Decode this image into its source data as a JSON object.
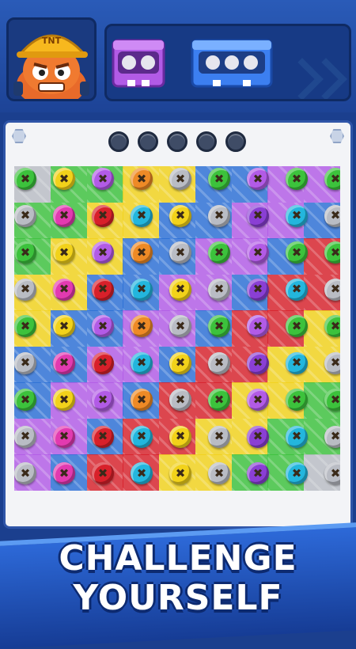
{
  "avatar": {
    "badge_text": "TNT",
    "icon": "miner-character-icon"
  },
  "toolboxes": [
    {
      "name": "purple-toolbox",
      "color": "#b25be6",
      "holes": 2
    },
    {
      "name": "blue-toolbox",
      "color": "#3c7ff0",
      "holes": 3
    }
  ],
  "slots": {
    "count": 5,
    "color": "#3f4c66"
  },
  "banner": {
    "line1": "CHALLENGE",
    "line2": "YOURSELF"
  },
  "palette": {
    "G": "#3cc23c",
    "Y": "#f2d21a",
    "P": "#b25be6",
    "O": "#ee8a26",
    "S": "#b9bcc4",
    "M": "#e23ab0",
    "R": "#d8202a",
    "C": "#23b6dd",
    "B": "#2a6fd6",
    "V": "#8a3fd4"
  },
  "board_colors": [
    [
      "S",
      "G",
      "G",
      "Y",
      "Y",
      "B",
      "B",
      "P",
      "P"
    ],
    [
      "G",
      "G",
      "Y",
      "Y",
      "B",
      "B",
      "P",
      "P",
      "B"
    ],
    [
      "G",
      "Y",
      "Y",
      "B",
      "B",
      "P",
      "P",
      "B",
      "R"
    ],
    [
      "Y",
      "Y",
      "B",
      "B",
      "P",
      "P",
      "B",
      "R",
      "R"
    ],
    [
      "Y",
      "B",
      "B",
      "P",
      "P",
      "B",
      "R",
      "R",
      "Y"
    ],
    [
      "B",
      "B",
      "P",
      "P",
      "B",
      "R",
      "R",
      "Y",
      "Y"
    ],
    [
      "B",
      "P",
      "P",
      "B",
      "R",
      "R",
      "Y",
      "Y",
      "G"
    ],
    [
      "P",
      "P",
      "B",
      "R",
      "R",
      "Y",
      "Y",
      "G",
      "G"
    ],
    [
      "P",
      "B",
      "R",
      "R",
      "Y",
      "Y",
      "G",
      "G",
      "S"
    ]
  ],
  "screws": [
    [
      "G",
      "Y",
      "P",
      "O",
      "S",
      "G",
      "P",
      "G",
      "G"
    ],
    [
      "S",
      "M",
      "R",
      "C",
      "Y",
      "S",
      "V",
      "C",
      "S"
    ],
    [
      "G",
      "Y",
      "P",
      "O",
      "S",
      "G",
      "P",
      "G",
      "G"
    ],
    [
      "S",
      "M",
      "R",
      "C",
      "Y",
      "S",
      "V",
      "C",
      "S"
    ],
    [
      "G",
      "Y",
      "P",
      "O",
      "S",
      "G",
      "P",
      "G",
      "G"
    ],
    [
      "S",
      "M",
      "R",
      "C",
      "Y",
      "S",
      "V",
      "C",
      "S"
    ],
    [
      "G",
      "Y",
      "P",
      "O",
      "S",
      "G",
      "P",
      "G",
      "G"
    ],
    [
      "S",
      "M",
      "R",
      "C",
      "Y",
      "S",
      "V",
      "C",
      "S"
    ],
    [
      "S",
      "M",
      "R",
      "C",
      "Y",
      "S",
      "V",
      "C",
      "S"
    ]
  ]
}
